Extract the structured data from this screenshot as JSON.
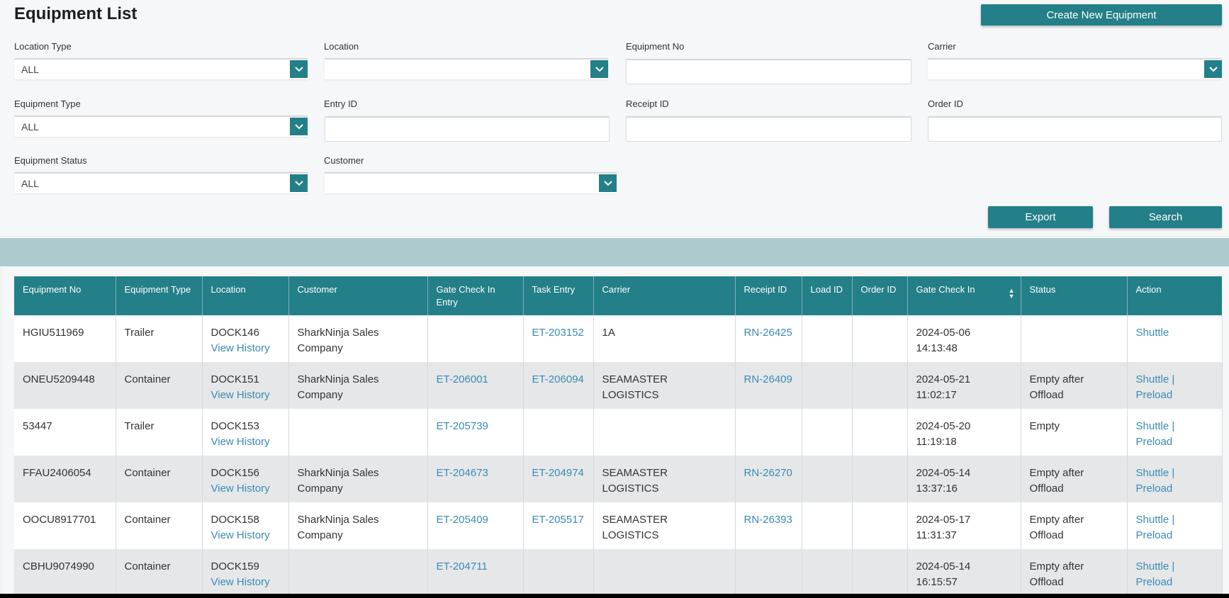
{
  "header": {
    "title": "Equipment List",
    "create_button": "Create New Equipment"
  },
  "filters": {
    "location_type": {
      "label": "Location Type",
      "value": "ALL"
    },
    "location": {
      "label": "Location",
      "value": ""
    },
    "equipment_no": {
      "label": "Equipment No",
      "value": ""
    },
    "carrier": {
      "label": "Carrier",
      "value": ""
    },
    "equipment_type": {
      "label": "Equipment Type",
      "value": "ALL"
    },
    "entry_id": {
      "label": "Entry ID",
      "value": ""
    },
    "receipt_id": {
      "label": "Receipt ID",
      "value": ""
    },
    "order_id": {
      "label": "Order ID",
      "value": ""
    },
    "equipment_status": {
      "label": "Equipment Status",
      "value": "ALL"
    },
    "customer": {
      "label": "Customer",
      "value": ""
    }
  },
  "actions": {
    "export": "Export",
    "search": "Search"
  },
  "table": {
    "columns": [
      "Equipment No",
      "Equipment Type",
      "Location",
      "Customer",
      "Gate Check In Entry",
      "Task Entry",
      "Carrier",
      "Receipt ID",
      "Load ID",
      "Order ID",
      "Gate Check In",
      "Status",
      "Action"
    ],
    "view_history_label": "View History",
    "rows": [
      {
        "equipment_no": "HGIU511969",
        "type": "Trailer",
        "location": "DOCK146",
        "customer": "SharkNinja Sales Company",
        "gate_entry": "",
        "task_entry": "ET-203152",
        "carrier": "1A",
        "receipt_id": "RN-26425",
        "load_id": "",
        "order_id": "",
        "gate_check_in_date": "2024-05-06",
        "gate_check_in_time": "14:13:48",
        "status": "",
        "actions": [
          "Shuttle"
        ]
      },
      {
        "equipment_no": "ONEU5209448",
        "type": "Container",
        "location": "DOCK151",
        "customer": "SharkNinja Sales Company",
        "gate_entry": "ET-206001",
        "task_entry": "ET-206094",
        "carrier": "SEAMASTER LOGISTICS",
        "receipt_id": "RN-26409",
        "load_id": "",
        "order_id": "",
        "gate_check_in_date": "2024-05-21",
        "gate_check_in_time": "11:02:17",
        "status": "Empty after Offload",
        "actions": [
          "Shuttle",
          "Preload"
        ]
      },
      {
        "equipment_no": "53447",
        "type": "Trailer",
        "location": "DOCK153",
        "customer": "",
        "gate_entry": "ET-205739",
        "task_entry": "",
        "carrier": "",
        "receipt_id": "",
        "load_id": "",
        "order_id": "",
        "gate_check_in_date": "2024-05-20",
        "gate_check_in_time": "11:19:18",
        "status": "Empty",
        "actions": [
          "Shuttle",
          "Preload"
        ]
      },
      {
        "equipment_no": "FFAU2406054",
        "type": "Container",
        "location": "DOCK156",
        "customer": "SharkNinja Sales Company",
        "gate_entry": "ET-204673",
        "task_entry": "ET-204974",
        "carrier": "SEAMASTER LOGISTICS",
        "receipt_id": "RN-26270",
        "load_id": "",
        "order_id": "",
        "gate_check_in_date": "2024-05-14",
        "gate_check_in_time": "13:37:16",
        "status": "Empty after Offload",
        "actions": [
          "Shuttle",
          "Preload"
        ]
      },
      {
        "equipment_no": "OOCU8917701",
        "type": "Container",
        "location": "DOCK158",
        "customer": "SharkNinja Sales Company",
        "gate_entry": "ET-205409",
        "task_entry": "ET-205517",
        "carrier": "SEAMASTER LOGISTICS",
        "receipt_id": "RN-26393",
        "load_id": "",
        "order_id": "",
        "gate_check_in_date": "2024-05-17",
        "gate_check_in_time": "11:31:37",
        "status": "Empty after Offload",
        "actions": [
          "Shuttle",
          "Preload"
        ]
      },
      {
        "equipment_no": "CBHU9074990",
        "type": "Container",
        "location": "DOCK159",
        "customer": "",
        "gate_entry": "ET-204711",
        "task_entry": "",
        "carrier": "",
        "receipt_id": "",
        "load_id": "",
        "order_id": "",
        "gate_check_in_date": "2024-05-14",
        "gate_check_in_time": "16:15:57",
        "status": "Empty after Offload",
        "actions": [
          "Shuttle",
          "Preload"
        ]
      }
    ]
  },
  "colors": {
    "primary": "#237f88",
    "band": "#adcbcf",
    "link": "#3a8bb5",
    "row_alt": "#e5e7e8"
  }
}
